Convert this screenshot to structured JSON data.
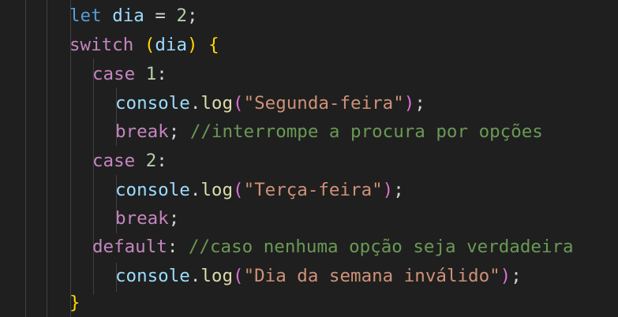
{
  "code": {
    "lines": [
      {
        "tokens": [
          {
            "t": "let",
            "c": "kw-decl"
          },
          {
            "t": " "
          },
          {
            "t": "dia",
            "c": "var"
          },
          {
            "t": " = "
          },
          {
            "t": "2",
            "c": "num"
          },
          {
            "t": ";"
          }
        ]
      },
      {
        "tokens": [
          {
            "t": "switch",
            "c": "kw-ctrl"
          },
          {
            "t": " "
          },
          {
            "t": "(",
            "c": "brace"
          },
          {
            "t": "dia",
            "c": "var"
          },
          {
            "t": ")",
            "c": "brace"
          },
          {
            "t": " "
          },
          {
            "t": "{",
            "c": "brace"
          }
        ]
      },
      {
        "tokens": [
          {
            "t": "case",
            "c": "kw-ctrl"
          },
          {
            "t": " "
          },
          {
            "t": "1",
            "c": "num"
          },
          {
            "t": ":"
          }
        ]
      },
      {
        "tokens": [
          {
            "t": "console",
            "c": "var"
          },
          {
            "t": "."
          },
          {
            "t": "log",
            "c": "fn"
          },
          {
            "t": "(",
            "c": "paren"
          },
          {
            "t": "\"Segunda-feira\"",
            "c": "str"
          },
          {
            "t": ")",
            "c": "paren"
          },
          {
            "t": ";"
          }
        ]
      },
      {
        "tokens": [
          {
            "t": "break",
            "c": "kw-ctrl"
          },
          {
            "t": "; "
          },
          {
            "t": "//interrompe a procura por opções",
            "c": "cmt"
          }
        ]
      },
      {
        "tokens": [
          {
            "t": "case",
            "c": "kw-ctrl"
          },
          {
            "t": " "
          },
          {
            "t": "2",
            "c": "num"
          },
          {
            "t": ":"
          }
        ]
      },
      {
        "tokens": [
          {
            "t": "console",
            "c": "var"
          },
          {
            "t": "."
          },
          {
            "t": "log",
            "c": "fn"
          },
          {
            "t": "(",
            "c": "paren"
          },
          {
            "t": "\"Terça-feira\"",
            "c": "str"
          },
          {
            "t": ")",
            "c": "paren"
          },
          {
            "t": ";"
          }
        ]
      },
      {
        "tokens": [
          {
            "t": "break",
            "c": "kw-ctrl"
          },
          {
            "t": ";"
          }
        ]
      },
      {
        "tokens": [
          {
            "t": "default",
            "c": "kw-ctrl"
          },
          {
            "t": ": "
          },
          {
            "t": "//caso nenhuma opção seja verdadeira",
            "c": "cmt"
          }
        ]
      },
      {
        "tokens": [
          {
            "t": "console",
            "c": "var"
          },
          {
            "t": "."
          },
          {
            "t": "log",
            "c": "fn"
          },
          {
            "t": "(",
            "c": "paren"
          },
          {
            "t": "\"Dia da semana inválido\"",
            "c": "str"
          },
          {
            "t": ")",
            "c": "paren"
          },
          {
            "t": ";"
          }
        ]
      },
      {
        "tokens": [
          {
            "t": "}",
            "c": "brace"
          }
        ]
      }
    ]
  }
}
